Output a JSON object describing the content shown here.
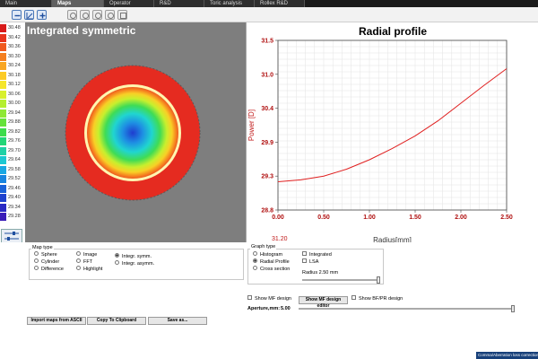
{
  "tabs": [
    {
      "label": "Main",
      "active": false
    },
    {
      "label": "Maps",
      "active": true
    },
    {
      "label": "Operator",
      "active": false
    },
    {
      "label": "R&D",
      "active": false
    },
    {
      "label": "Toric analysis",
      "active": false
    },
    {
      "label": "Rollex R&D",
      "active": false
    }
  ],
  "toolbar": {
    "icons": [
      "zoom-out-icon",
      "axis-icon",
      "zoom-in-icon",
      "icon-1",
      "icon-2",
      "icon-3",
      "icon-4",
      "icon-5"
    ]
  },
  "legend": {
    "values": [
      "30.48",
      "30.42",
      "30.36",
      "30.30",
      "30.24",
      "30.18",
      "30.12",
      "30.06",
      "30.00",
      "29.94",
      "29.88",
      "29.82",
      "29.76",
      "29.70",
      "29.64",
      "29.58",
      "29.52",
      "29.46",
      "29.40",
      "29.34",
      "29.28"
    ],
    "colors": [
      "#d81a1a",
      "#e8341d",
      "#f0591e",
      "#f57f1f",
      "#f9a623",
      "#fccb26",
      "#f5e62a",
      "#d8f02c",
      "#b4ef30",
      "#8ee834",
      "#66e23a",
      "#3ddc4b",
      "#22d678",
      "#1fd1a6",
      "#1dc8d2",
      "#1aa8e3",
      "#1985e0",
      "#1a62d8",
      "#1f42ce",
      "#2a2ac4",
      "#3a1cb8"
    ]
  },
  "map": {
    "title": "Integrated symmetric"
  },
  "profile": {
    "title": "Radial profile",
    "footer_value": "31.20"
  },
  "chart_data": {
    "type": "line",
    "title": "Radial profile",
    "xlabel": "Radius[mm]",
    "ylabel": "Power [D]",
    "xlim": [
      0.0,
      2.5
    ],
    "ylim": [
      28.8,
      31.5
    ],
    "xticks": [
      "0.00",
      "0.50",
      "1.00",
      "1.50",
      "2.00",
      "2.50"
    ],
    "yticks": [
      "31.5",
      "31.0",
      "30.4",
      "29.9",
      "29.3",
      "28.8"
    ],
    "grid": true,
    "series": [
      {
        "color": "#e02020",
        "x": [
          0.0,
          0.25,
          0.5,
          0.75,
          1.0,
          1.25,
          1.5,
          1.75,
          2.0,
          2.25,
          2.5
        ],
        "y": [
          29.25,
          29.28,
          29.34,
          29.45,
          29.6,
          29.78,
          29.98,
          30.22,
          30.5,
          30.78,
          31.05
        ]
      }
    ]
  },
  "map_type": {
    "label": "Map type",
    "options": [
      "Sphere",
      "Cylinder",
      "Difference",
      "Image",
      "FFT",
      "Highlight",
      "Integr. symm.",
      "Integr. asymm."
    ],
    "selected": "Integr. symm."
  },
  "graph_type": {
    "label": "Graph type",
    "options": [
      "Histogram",
      "Radial Profile",
      "Cross section"
    ],
    "selected": "Radial Profile",
    "checks": [
      "Integrated",
      "LSA"
    ],
    "radius_text": "Radius 2.50 mm"
  },
  "design": {
    "show_mf": "Show MF design",
    "editor_button": "Show MF design editor",
    "show_bf": "Show BF/PR design",
    "aperture_label": "Aperture,mm:",
    "aperture_value": "5.00"
  },
  "buttons": {
    "import": "Import maps from ASCII",
    "copy": "Copy To Clipboard",
    "save": "Save as..."
  },
  "status": {
    "text": "Comma/Aberration loss correction MTF"
  }
}
